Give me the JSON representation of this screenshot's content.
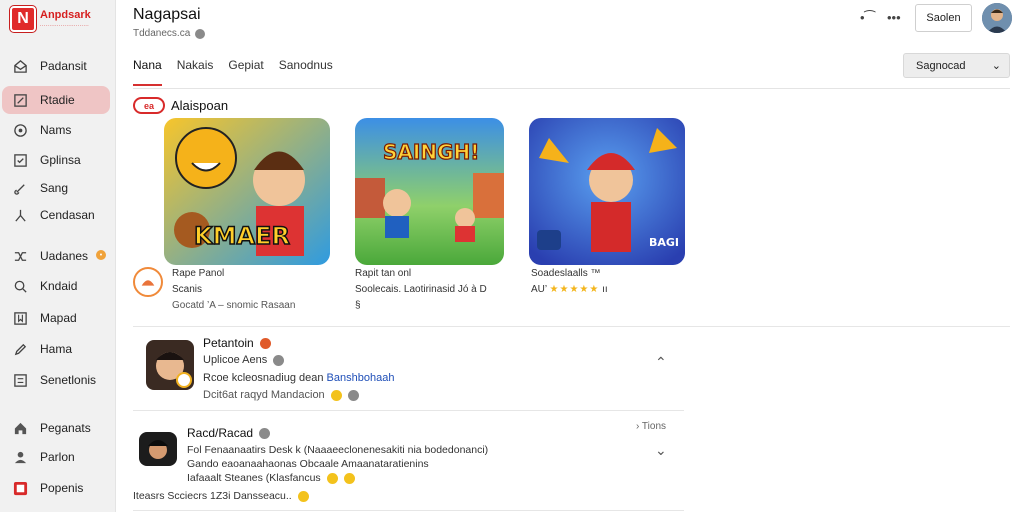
{
  "brand": {
    "name": "Anpdsark",
    "tagline": "..........................",
    "mark": "N"
  },
  "sidebar": {
    "items": [
      {
        "label": "Padansit",
        "icon": "mail-open-icon"
      },
      {
        "label": "Rtadie",
        "icon": "edit-square-icon",
        "active": true
      },
      {
        "label": "Nams",
        "icon": "compass-icon"
      },
      {
        "label": "Gplinsa",
        "icon": "document-check-icon"
      },
      {
        "label": "Sang",
        "icon": "music-icon"
      },
      {
        "label": "Cendasan",
        "icon": "person-icon"
      },
      {
        "label": "Uadanes",
        "icon": "shuffle-icon",
        "badge": "•"
      },
      {
        "label": "Kndaid",
        "icon": "search-icon"
      },
      {
        "label": "Mapad",
        "icon": "bookmark-icon"
      },
      {
        "label": "Hama",
        "icon": "pen-icon"
      },
      {
        "label": "Senetlonis",
        "icon": "list-icon"
      },
      {
        "label": "Peganats",
        "icon": "home-icon"
      },
      {
        "label": "Parlon",
        "icon": "user-icon"
      },
      {
        "label": "Popenis",
        "icon": "red-square-icon"
      }
    ]
  },
  "header": {
    "title": "Nagapsai",
    "subtitle": "Tddanecs.ca",
    "button_label": "Saolen"
  },
  "tabs": [
    "Nana",
    "Nakais",
    "Gepiat",
    "Sanodnus"
  ],
  "dropdown": {
    "value": "Sagnocad"
  },
  "section": {
    "logo_text": "ea",
    "title": "Alaispoan"
  },
  "cards": [
    {
      "title": "Rape Panol",
      "line2": "Scanis",
      "line3": "Gocatd ’A – snomic Rasaan",
      "art_text": "KMAER"
    },
    {
      "title": "Rapit tan onl",
      "line2": "Soolecais. Laotirinasid Jó à D",
      "line3": "§",
      "art_text": "SAINGH!"
    },
    {
      "title": "Soadeslaalls ™",
      "rating_prefix": "AU’",
      "stars": "★★★★★",
      "rating_suffix": "ıı",
      "art_text": "BAGI"
    }
  ],
  "list": [
    {
      "title": "Petantoin",
      "line1": "Uplicoe Aens",
      "line2_prefix": "Rcoe kcleosnadiug dean",
      "line2_link": "Banshbohaah",
      "line3": "Dcit6at raqyd Mandacion"
    },
    {
      "title": "Racd/Racad",
      "meta": "› Tions",
      "line1": "Fol  Fenaanaatirs Desk k  (Naaaeeclonenesakiti  nia  bodedonanci)",
      "line2": "Gando  eaoanaahaonas Obcaale  Amaanataratienins",
      "line3": "Iafaaalt  Steanes  (Klasfancus",
      "footer": "Iteasrs   Scciecrs  1Z3i  Dansseacu.."
    }
  ],
  "colors": {
    "accent": "#d63030",
    "active_bg": "#efc5c5",
    "link": "#1f4fb8",
    "star": "#f3b51c"
  }
}
